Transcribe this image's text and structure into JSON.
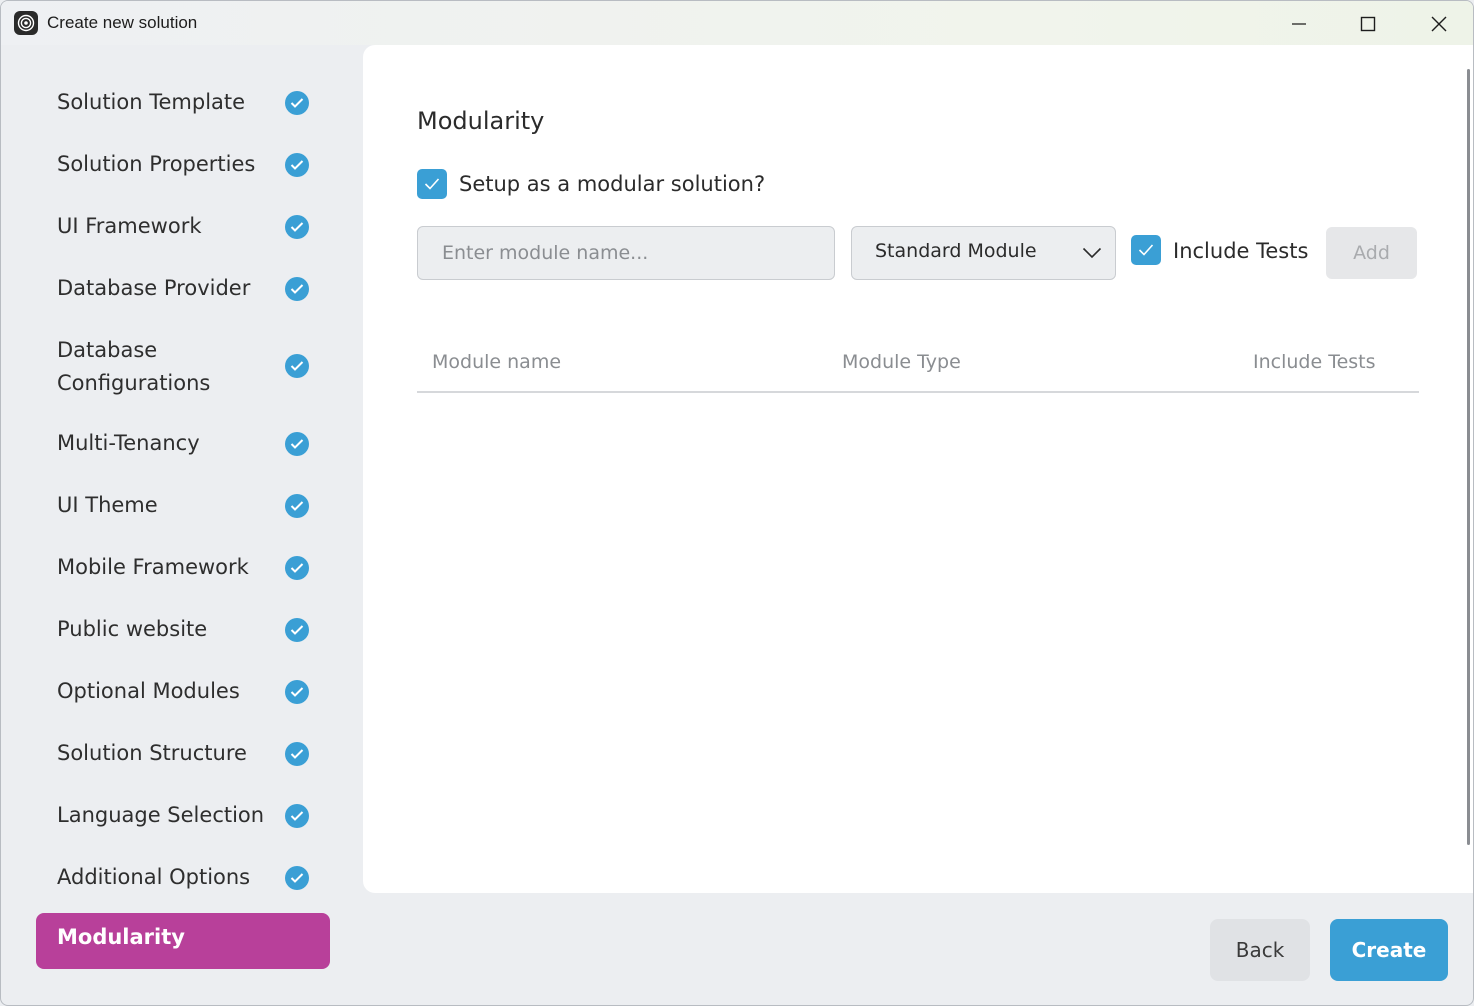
{
  "window": {
    "title": "Create new solution",
    "icon": "abp-studio-logo-icon"
  },
  "sidebar": {
    "steps": [
      {
        "label": "Solution Template",
        "status": "completed"
      },
      {
        "label": "Solution Properties",
        "status": "completed"
      },
      {
        "label": "UI Framework",
        "status": "completed"
      },
      {
        "label": "Database Provider",
        "status": "completed"
      },
      {
        "label": "Database Configurations",
        "status": "completed"
      },
      {
        "label": "Multi-Tenancy",
        "status": "completed"
      },
      {
        "label": "UI Theme",
        "status": "completed"
      },
      {
        "label": "Mobile Framework",
        "status": "completed"
      },
      {
        "label": "Public website",
        "status": "completed"
      },
      {
        "label": "Optional Modules",
        "status": "completed"
      },
      {
        "label": "Solution Structure",
        "status": "completed"
      },
      {
        "label": "Language Selection",
        "status": "completed"
      },
      {
        "label": "Additional Options",
        "status": "completed"
      }
    ],
    "active_step": "Modularity"
  },
  "main": {
    "title": "Modularity",
    "modular_checkbox": {
      "label": "Setup as a modular solution?",
      "checked": true
    },
    "module_input": {
      "value": "",
      "placeholder": "Enter module name..."
    },
    "module_type_select": {
      "selected": "Standard Module"
    },
    "include_tests_checkbox": {
      "label": "Include Tests",
      "checked": true
    },
    "add_button": "Add",
    "table": {
      "columns": [
        "Module name",
        "Module Type",
        "Include Tests"
      ],
      "rows": []
    }
  },
  "footer": {
    "back_button": "Back",
    "create_button": "Create"
  },
  "colors": {
    "accent": "#3a9fd5",
    "active_step": "#b8409a",
    "sidebar_bg": "#eceef1"
  }
}
